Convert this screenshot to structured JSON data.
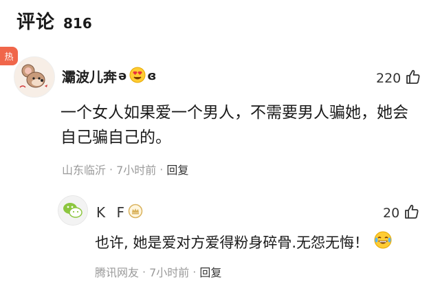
{
  "header": {
    "title": "评论",
    "count": "816"
  },
  "hot_badge": "热",
  "comment": {
    "username": "灞波儿奔",
    "name_suffix_left": "ə",
    "name_suffix_right": "ɞ",
    "likes": "220",
    "text": "一个女人如果爱一个男人，不需要男人骗她，她会自己骗自己的。",
    "location": "山东临沂",
    "time": "7小时前",
    "reply_label": "回复"
  },
  "reply": {
    "username": "K F",
    "likes": "20",
    "text": "也许, 她是爱对方爱得粉身碎骨.无怨无悔！",
    "location": "腾讯网友",
    "time": "7小时前",
    "reply_label": "回复"
  },
  "colors": {
    "hot_badge": "#f0664a",
    "meta_gray": "#9a9a9a",
    "text": "#1a1a1a"
  },
  "icons": [
    "thumbs-up-icon",
    "heart-eyes-emoji-icon",
    "laughing-tears-emoji-icon",
    "vip-badge-icon",
    "wechat-avatar-icon",
    "jerry-mouse-avatar-icon"
  ]
}
